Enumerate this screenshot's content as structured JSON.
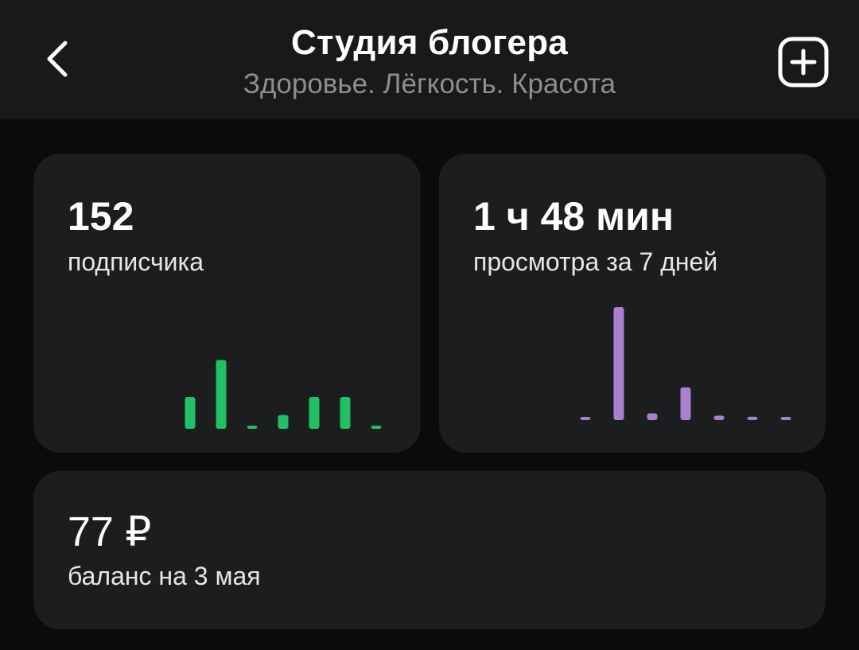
{
  "header": {
    "title": "Студия блогера",
    "subtitle": "Здоровье. Лёгкость. Красота",
    "back_icon": "chevron-left-icon",
    "add_icon": "plus-square-icon"
  },
  "subscribers": {
    "value": "152",
    "caption": "подписчика"
  },
  "views": {
    "value": "1 ч 48 мин",
    "caption": "просмотра за 7 дней"
  },
  "balance": {
    "value": "77 ₽",
    "caption": "баланс на 3 мая"
  },
  "colors": {
    "background": "#0a0b0b",
    "header": "#17191a",
    "card": "#1b1d1e",
    "subscribers_bars": "#22c064",
    "views_bars": "#a97fd0",
    "subtitle": "#8c8e90"
  },
  "chart_data": [
    {
      "type": "bar",
      "values": [
        3,
        6.5,
        0.3,
        1.3,
        3,
        3,
        0.3
      ],
      "ylim": [
        0,
        12
      ],
      "grid": false,
      "color": "#22c064"
    },
    {
      "type": "bar",
      "values": [
        0.2,
        10,
        0.6,
        2.9,
        0.4,
        0.3,
        0.2
      ],
      "ylim": [
        0,
        10
      ],
      "grid": false,
      "color": "#a97fd0"
    }
  ]
}
